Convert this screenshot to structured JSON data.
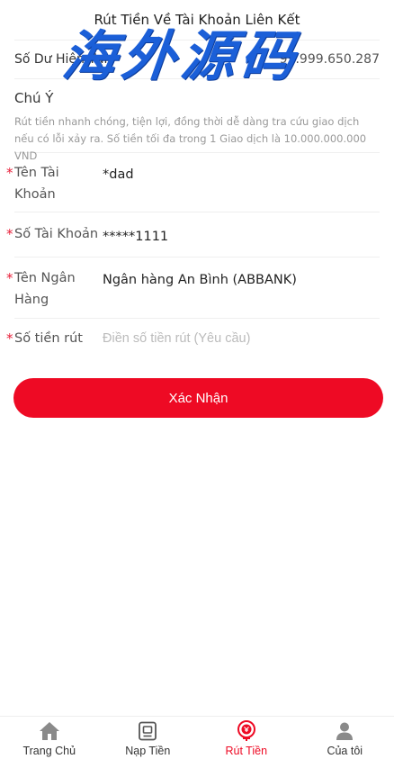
{
  "header": {
    "title": "Rút Tiền Về Tài Khoản Liên Kết",
    "watermark": "海外源码"
  },
  "balance": {
    "label": "Số Dư Hiện Tại",
    "value": "99.999.650.287"
  },
  "note": {
    "title": "Chú Ý",
    "text": "Rút tiền nhanh chóng, tiện lợi, đồng thời dễ dàng tra cứu giao dịch nếu có lỗi xảy ra. Số tiền tối đa trong 1 Giao dịch là 10.000.000.000 VND"
  },
  "form": {
    "required_mark": "*",
    "account_name_label": "Tên Tài Khoản",
    "account_name_value": "*dad",
    "account_number_label": "Số Tài Khoản",
    "account_number_value": "*****1111",
    "bank_name_label": "Tên Ngân Hàng",
    "bank_name_value": "Ngân hàng An Bình (ABBANK)",
    "amount_label": "Số tiền rút",
    "amount_placeholder": "Điền số tiền rút (Yêu cầu)",
    "amount_value": ""
  },
  "confirm_label": "Xác Nhận",
  "tabbar": {
    "items": [
      {
        "label": "Trang Chủ",
        "icon": "home-icon"
      },
      {
        "label": "Nạp Tiền",
        "icon": "deposit-icon"
      },
      {
        "label": "Rút Tiền",
        "icon": "withdraw-icon",
        "active": true
      },
      {
        "label": "Của tôi",
        "icon": "user-icon"
      }
    ]
  },
  "colors": {
    "accent": "#ee0a24",
    "watermark": "#1b5fd8"
  }
}
